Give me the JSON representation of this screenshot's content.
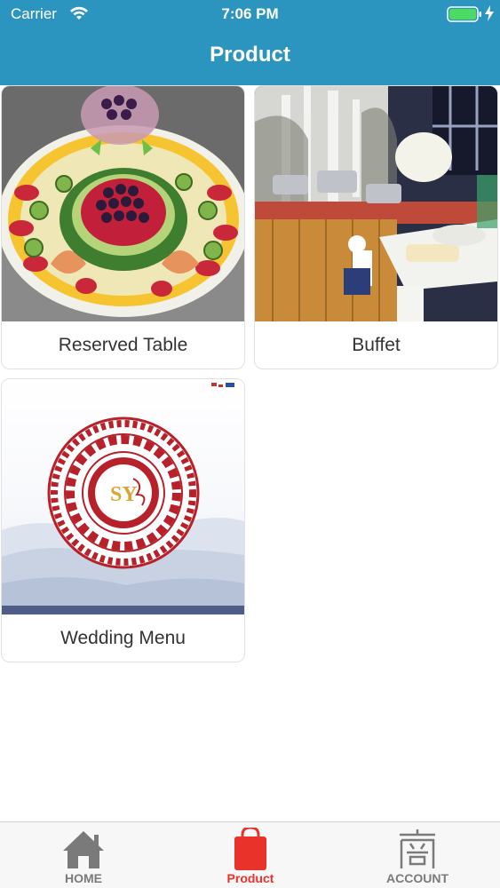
{
  "status_bar": {
    "carrier": "Carrier",
    "time": "7:06 PM"
  },
  "nav": {
    "title": "Product"
  },
  "products": [
    {
      "label": "Reserved Table",
      "image": "fruit-platter-image"
    },
    {
      "label": "Buffet",
      "image": "buffet-image"
    },
    {
      "label": "Wedding Menu",
      "image": "wedding-menu-image",
      "logo_text": "SY"
    }
  ],
  "tabbar": {
    "items": [
      {
        "label": "HOME",
        "icon": "home-icon",
        "active": false
      },
      {
        "label": "Product",
        "icon": "shopping-bag-icon",
        "active": true
      },
      {
        "label": "ACCOUNT",
        "icon": "account-icon",
        "active": false
      }
    ],
    "active_color": "#e8322a",
    "inactive_color": "#7a7a7a"
  },
  "colors": {
    "header": "#2c95bf",
    "battery": "#4cd964"
  }
}
